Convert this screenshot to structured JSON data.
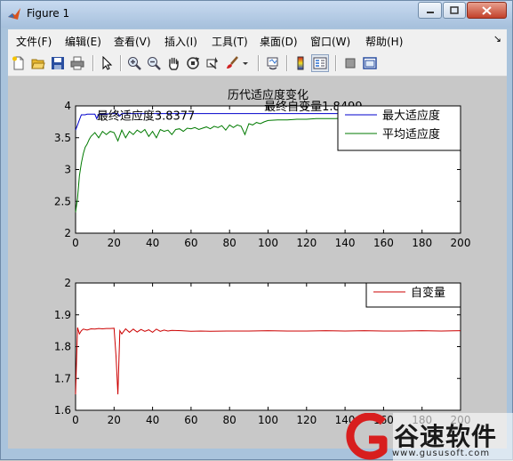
{
  "window": {
    "title": "Figure 1"
  },
  "menu": {
    "items": [
      {
        "label": "文件(F)",
        "name": "menu-file"
      },
      {
        "label": "编辑(E)",
        "name": "menu-edit"
      },
      {
        "label": "查看(V)",
        "name": "menu-view"
      },
      {
        "label": "插入(I)",
        "name": "menu-insert"
      },
      {
        "label": "工具(T)",
        "name": "menu-tools"
      },
      {
        "label": "桌面(D)",
        "name": "menu-desktop"
      },
      {
        "label": "窗口(W)",
        "name": "menu-window"
      },
      {
        "label": "帮助(H)",
        "name": "menu-help"
      }
    ]
  },
  "toolbar": {
    "icons": [
      "new-file-icon",
      "open-folder-icon",
      "save-icon",
      "print-icon",
      "pointer-icon",
      "zoom-in-icon",
      "zoom-out-icon",
      "pan-hand-icon",
      "rotate-3d-icon",
      "data-cursor-icon",
      "brush-icon",
      "link-icon",
      "colorbar-icon",
      "legend-icon",
      "hide-plot-tools-icon",
      "show-plot-tools-icon"
    ]
  },
  "watermark": {
    "brand": "谷速软件",
    "url": "www.gususoft.com"
  },
  "chart_data": [
    {
      "type": "line",
      "title": "历代适应度变化",
      "xlim": [
        0,
        200
      ],
      "ylim": [
        2,
        4
      ],
      "xticks": [
        0,
        20,
        40,
        60,
        80,
        100,
        120,
        140,
        160,
        180,
        200
      ],
      "yticks": [
        2,
        2.5,
        3,
        3.5,
        4
      ],
      "grid": false,
      "legend_position": "top-right",
      "annotations": [
        {
          "text": "最终适应度3.8377",
          "x": 11,
          "y": 3.78
        },
        {
          "text": "最终自变量1.8499",
          "x": 98,
          "y": 3.93
        }
      ],
      "series": [
        {
          "name": "最大适应度",
          "color": "#0000cc",
          "x": [
            0,
            1,
            2,
            3,
            4,
            5,
            6,
            7,
            8,
            9,
            10,
            11,
            12,
            13,
            14,
            20,
            22,
            23,
            24,
            26,
            30,
            40,
            60,
            80,
            100,
            120,
            140,
            160,
            180,
            200
          ],
          "y": [
            3.62,
            3.7,
            3.78,
            3.86,
            3.86,
            3.86,
            3.87,
            3.87,
            3.87,
            3.87,
            3.87,
            3.8,
            3.87,
            3.87,
            3.87,
            3.88,
            3.88,
            3.84,
            3.88,
            3.88,
            3.88,
            3.88,
            3.88,
            3.88,
            3.88,
            3.88,
            3.88,
            3.88,
            3.88,
            3.88
          ]
        },
        {
          "name": "平均适应度",
          "color": "#007a00",
          "x": [
            0,
            1,
            2,
            3,
            4,
            5,
            6,
            7,
            8,
            9,
            10,
            12,
            14,
            16,
            18,
            20,
            22,
            24,
            26,
            28,
            30,
            32,
            34,
            36,
            38,
            40,
            42,
            44,
            46,
            48,
            50,
            52,
            54,
            56,
            58,
            60,
            62,
            64,
            66,
            68,
            70,
            72,
            74,
            76,
            78,
            80,
            82,
            84,
            86,
            88,
            90,
            92,
            94,
            96,
            98,
            100,
            105,
            110,
            115,
            120,
            125,
            130,
            135,
            140,
            145,
            150,
            155,
            160,
            165,
            170,
            175,
            180,
            185,
            190,
            195,
            200
          ],
          "y": [
            2.33,
            2.55,
            2.9,
            3.1,
            3.25,
            3.35,
            3.4,
            3.47,
            3.52,
            3.55,
            3.58,
            3.5,
            3.6,
            3.55,
            3.6,
            3.58,
            3.45,
            3.62,
            3.5,
            3.6,
            3.55,
            3.62,
            3.58,
            3.63,
            3.52,
            3.6,
            3.5,
            3.63,
            3.6,
            3.62,
            3.55,
            3.63,
            3.64,
            3.6,
            3.65,
            3.64,
            3.66,
            3.63,
            3.65,
            3.67,
            3.64,
            3.68,
            3.66,
            3.69,
            3.62,
            3.7,
            3.66,
            3.7,
            3.68,
            3.55,
            3.72,
            3.7,
            3.74,
            3.72,
            3.75,
            3.77,
            3.78,
            3.78,
            3.79,
            3.79,
            3.8,
            3.8,
            3.8,
            3.81,
            3.81,
            3.81,
            3.81,
            3.82,
            3.82,
            3.82,
            3.82,
            3.82,
            3.83,
            3.83,
            3.83,
            3.83
          ]
        }
      ]
    },
    {
      "type": "line",
      "title": "",
      "xlim": [
        0,
        200
      ],
      "ylim": [
        1.6,
        2
      ],
      "xticks": [
        0,
        20,
        40,
        60,
        80,
        100,
        120,
        140,
        160,
        180,
        200
      ],
      "yticks": [
        1.6,
        1.7,
        1.8,
        1.9,
        2
      ],
      "grid": false,
      "legend_position": "top-right",
      "series": [
        {
          "name": "自变量",
          "color": "#cc0000",
          "x": [
            0,
            1,
            2,
            3,
            4,
            6,
            8,
            10,
            12,
            14,
            16,
            18,
            20,
            21,
            22,
            23,
            24,
            26,
            28,
            30,
            32,
            34,
            36,
            38,
            40,
            42,
            44,
            46,
            48,
            50,
            55,
            60,
            65,
            70,
            80,
            90,
            100,
            110,
            120,
            130,
            140,
            150,
            160,
            170,
            180,
            190,
            200
          ],
          "y": [
            1.65,
            1.86,
            1.84,
            1.85,
            1.855,
            1.852,
            1.856,
            1.855,
            1.857,
            1.856,
            1.857,
            1.857,
            1.858,
            1.77,
            1.65,
            1.85,
            1.84,
            1.856,
            1.845,
            1.855,
            1.846,
            1.854,
            1.848,
            1.853,
            1.845,
            1.855,
            1.848,
            1.852,
            1.849,
            1.851,
            1.85,
            1.848,
            1.849,
            1.848,
            1.849,
            1.849,
            1.85,
            1.849,
            1.849,
            1.85,
            1.849,
            1.85,
            1.849,
            1.849,
            1.85,
            1.849,
            1.85
          ]
        }
      ]
    }
  ]
}
